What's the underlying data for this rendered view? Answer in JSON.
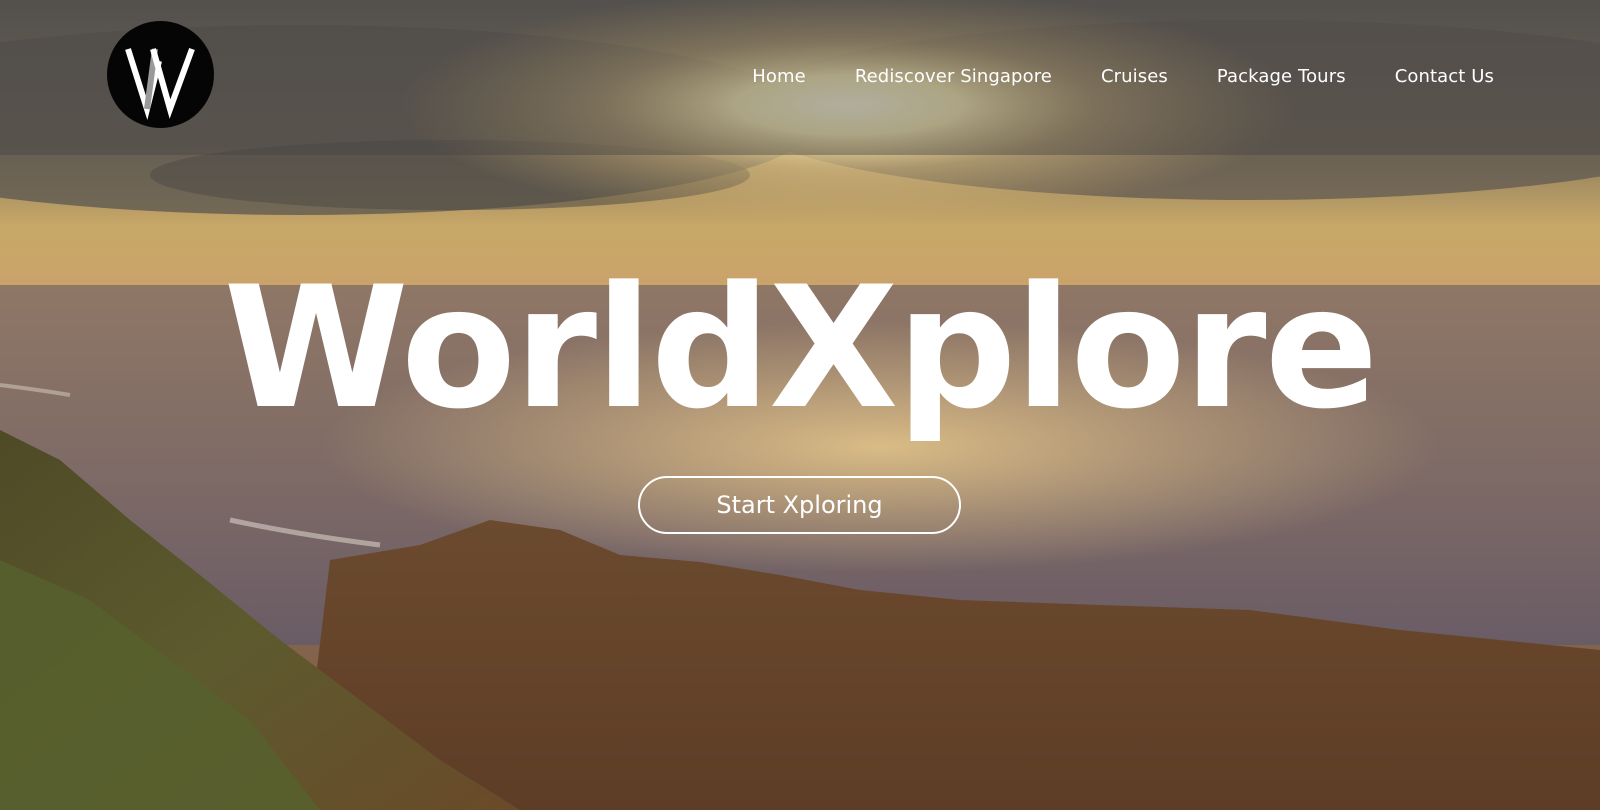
{
  "brand": {
    "logo_letter": "W",
    "logo_icon": "worldxplore-logo-icon"
  },
  "nav": {
    "items": [
      {
        "label": "Home"
      },
      {
        "label": "Rediscover Singapore"
      },
      {
        "label": "Cruises"
      },
      {
        "label": "Package Tours"
      },
      {
        "label": "Contact Us"
      }
    ]
  },
  "hero": {
    "title": "WorldXplore",
    "cta_label": "Start Xploring",
    "background": "sunset-over-ocean-coastline-image"
  },
  "colors": {
    "text": "#ffffff",
    "navbar_overlay": "rgba(70,66,66,0.42)",
    "logo_bg": "#050505"
  }
}
